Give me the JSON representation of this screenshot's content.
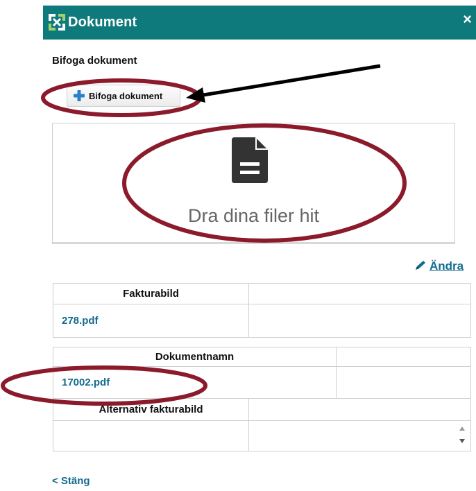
{
  "dialog": {
    "title": "Dokument",
    "close_glyph": "×",
    "header_color": "#0f7a7c",
    "logo_icon": "app-logo-icon"
  },
  "attach": {
    "section_title": "Bifoga dokument",
    "button_label": "Bifoga dokument",
    "button_icon": "plus-icon"
  },
  "dropzone": {
    "icon": "document-icon",
    "text": "Dra dina filer hit"
  },
  "edit": {
    "label": "Ändra",
    "icon": "pencil-icon"
  },
  "invoice_table": {
    "header": "Fakturabild",
    "file": "278.pdf"
  },
  "documents_table": {
    "header": "Dokumentnamn",
    "file": "17002.pdf",
    "alt_header": "Alternativ fakturabild"
  },
  "footer": {
    "close_label": "< Stäng"
  },
  "annotation_color": "#8b1a2b"
}
